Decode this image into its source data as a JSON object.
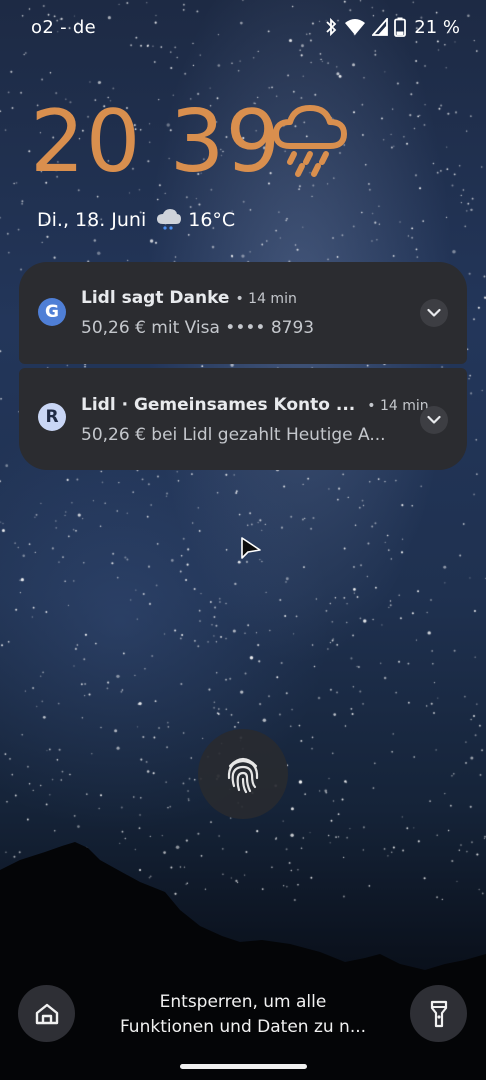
{
  "status_bar": {
    "carrier": "o2 - de",
    "battery_percent": "21 %"
  },
  "clock": {
    "time": "20 39",
    "weather_icon": "rain-cloud-icon"
  },
  "date_weather": {
    "date": "Di., 18. Juni",
    "weather_icon": "cloud-rain-icon",
    "temperature": "16°C"
  },
  "notifications": [
    {
      "app_icon": "G",
      "title": "Lidl sagt Danke",
      "time": "• 14 min",
      "body": "50,26 € mit Visa •••• 8793"
    },
    {
      "app_icon": "R",
      "title": "Lidl · Gemeinsames Konto ...",
      "time": "• 14 min",
      "body": "50,26 € bei Lidl gezahlt Heutige A..."
    }
  ],
  "lock_screen": {
    "unlock_hint_line1": "Entsperren, um alle",
    "unlock_hint_line2": "Funktionen und Daten zu n...",
    "left_shortcut_icon": "home-icon",
    "right_shortcut_icon": "flashlight-icon",
    "fingerprint_icon": "fingerprint-icon"
  },
  "colors": {
    "clock": "#d98f4e",
    "card": "#2b2c30"
  }
}
